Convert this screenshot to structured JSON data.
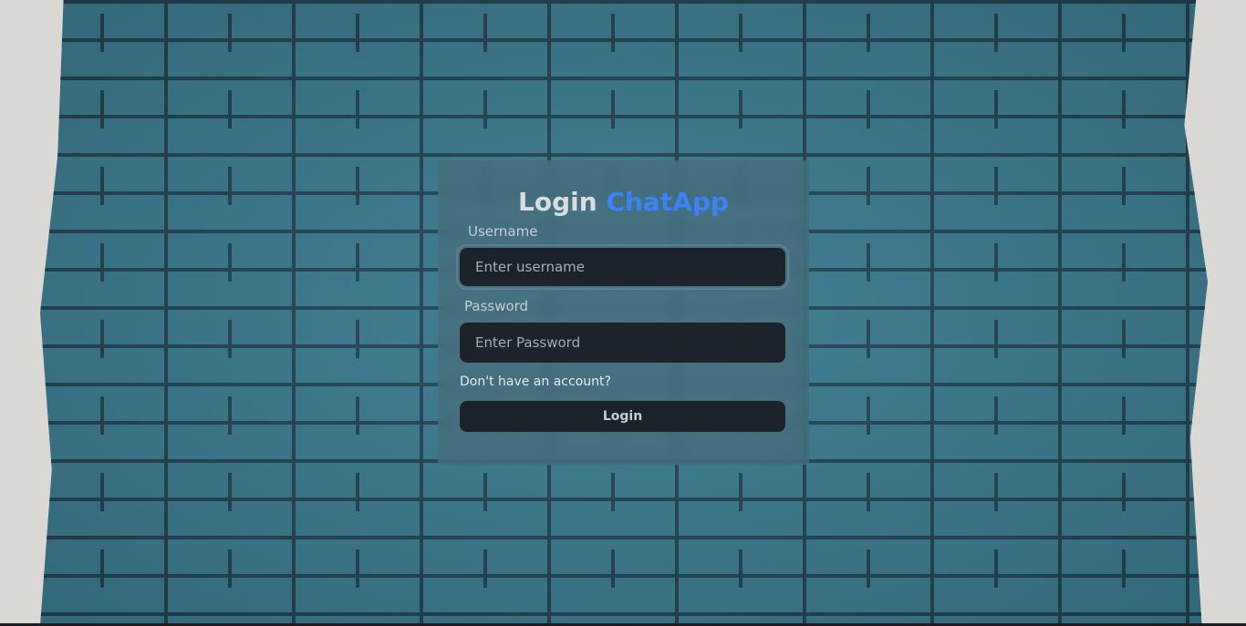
{
  "header": {
    "title_prefix": "Login",
    "title_brand": "ChatApp"
  },
  "form": {
    "username_label": "Username",
    "username_placeholder": "Enter username",
    "username_value": "",
    "password_label": "Password",
    "password_placeholder": "Enter Password",
    "password_value": "",
    "signup_link": "Don't have an account?",
    "login_button": "Login"
  },
  "colors": {
    "brand": "#3b82f6",
    "input_bg": "#1d232a",
    "wall_paint": "#3e7a8e"
  }
}
